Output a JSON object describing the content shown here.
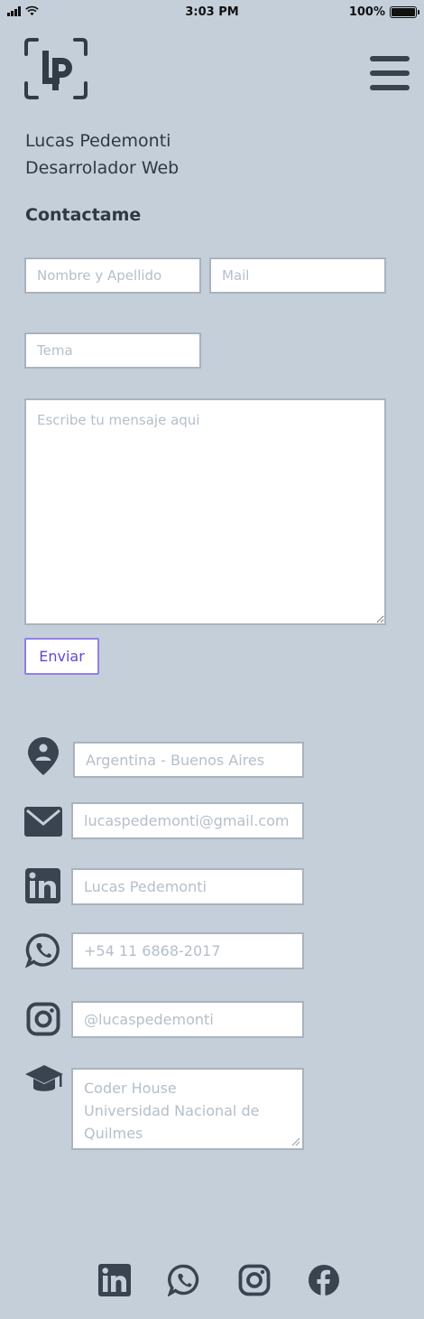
{
  "status_bar": {
    "time": "3:03 PM",
    "battery": "100%"
  },
  "header": {
    "logo_text": "LP",
    "menu_icon": "hamburger-menu-icon"
  },
  "profile": {
    "name": "Lucas Pedemonti",
    "role": "Desarrolador Web"
  },
  "contact_form": {
    "title": "Contactame",
    "name_placeholder": "Nombre y Apellido",
    "mail_placeholder": "Mail",
    "topic_placeholder": "Tema",
    "message_placeholder": "Escribe tu mensaje aqui",
    "send_label": "Enviar"
  },
  "contact_info": {
    "location": "Argentina - Buenos Aires",
    "email": "lucaspedemonti@gmail.com",
    "linkedin": "Lucas Pedemonti",
    "whatsapp": "+54 11 6868-2017",
    "instagram": "@lucaspedemonti",
    "education": "Coder House\nUniversidad Nacional de Quilmes"
  },
  "icons": [
    "location-pin-icon",
    "mail-icon",
    "linkedin-icon",
    "whatsapp-icon",
    "instagram-icon",
    "graduation-cap-icon",
    "facebook-icon"
  ],
  "colors": {
    "background": "#c4cfda",
    "icon": "#3a4350",
    "button_accent": "#5b4bdb"
  }
}
